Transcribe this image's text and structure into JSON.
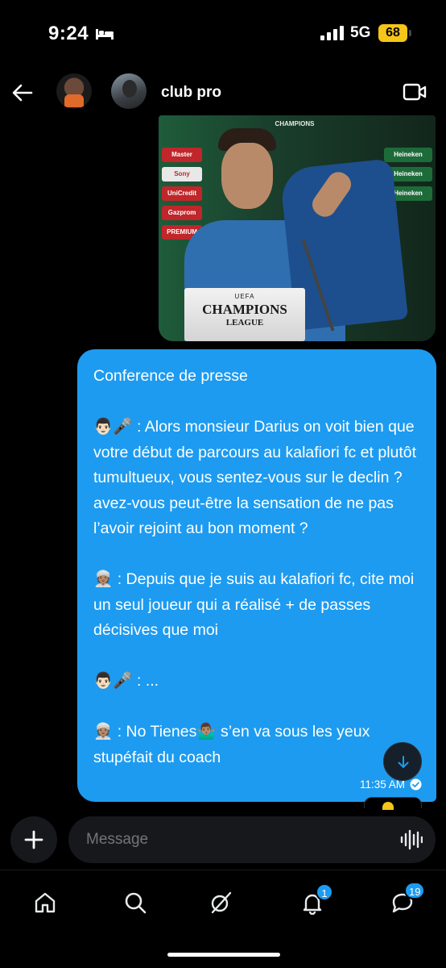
{
  "status_bar": {
    "time": "9:24",
    "network": "5G",
    "battery": "68",
    "battery_color": "#f5c518"
  },
  "header": {
    "title": "club pro",
    "back_icon": "arrow-left-icon",
    "call_icon": "video-camera-icon"
  },
  "image_message": {
    "plate_top": "UEFA",
    "plate_title": "CHAMPIONS",
    "plate_sub": "LEAGUE",
    "backdrop_logo": "CHAMPIONS",
    "sponsors_left": [
      "Master",
      "Sony",
      "UniCredit",
      "Gazprom",
      "PREMIUM"
    ],
    "sponsors_middle": [
      "Heineken",
      "Heineken"
    ],
    "sponsors_right": [
      "Heineken",
      "Heineken",
      "Heineken"
    ]
  },
  "text_message": {
    "text": "Conference de presse\n\n👨🏻🎤 : Alors monsieur Darius on voit bien que votre début de parcours au kalafiori fc et plutôt tumultueux, vous sentez-vous sur le declin ? avez-vous peut-être la sensation de ne pas l’avoir rejoint au bon moment ?\n\n👳🏽 : Depuis que je suis au kalafiori fc, cite moi un seul joueur qui a réalisé + de passes décisives que moi\n\n👨🏻🎤 : ...\n\n👳🏽 : No Tienes🤷🏽‍♂️ s’en va sous les yeux stupéfait du coach",
    "timestamp": "11:35 AM",
    "bubble_color": "#1d9bf0"
  },
  "composer": {
    "placeholder": "Message"
  },
  "bottom_nav": {
    "notifications_badge": "1",
    "messages_badge": "19",
    "accent": "#1d9bf0"
  }
}
